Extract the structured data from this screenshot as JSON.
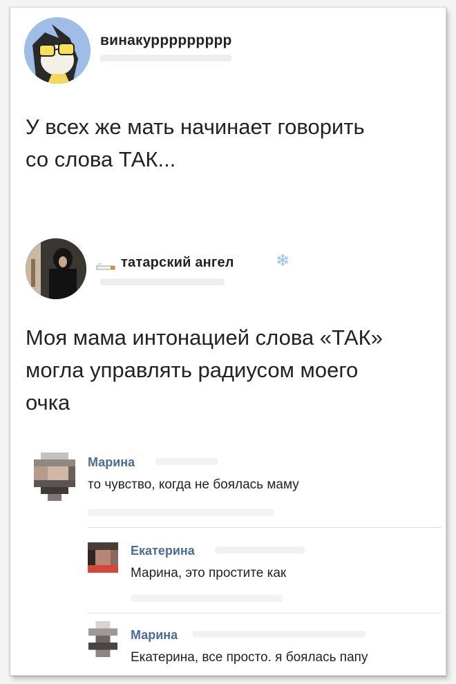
{
  "post1": {
    "username": "винакуррррррррр",
    "text_lines": [
      "У всех же мать начинает говорить",
      "со слова ТАК..."
    ]
  },
  "post2": {
    "username": "татарский ангел",
    "username_prefix_icon": "cigarette-icon",
    "username_suffix_icon": "snowflake-icon",
    "text_lines": [
      "Моя мама интонацией слова «ТАК»",
      "могла управлять радиусом моего",
      "очка"
    ]
  },
  "comments": [
    {
      "author": "Марина",
      "text": "то чувство, когда не боялась маму"
    },
    {
      "author": "Екатерина",
      "text": "Марина, это простите как"
    },
    {
      "author": "Марина",
      "text": "Екатерина, все просто. я боялась папу"
    }
  ],
  "colors": {
    "link": "#4a6c98",
    "text": "#222222",
    "divider": "#d8dfe7"
  }
}
